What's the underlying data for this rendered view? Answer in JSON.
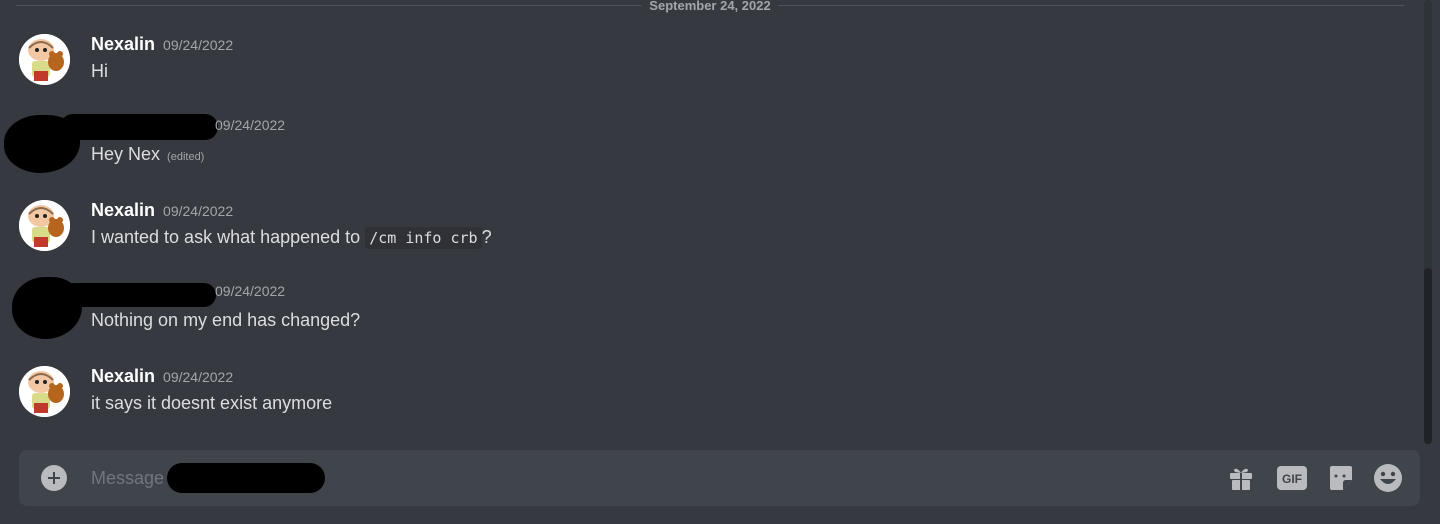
{
  "channel": {
    "date_divider": "September 24, 2022"
  },
  "messages": [
    {
      "username": "Nexalin",
      "timestamp": "09/24/2022",
      "text": "Hi",
      "edited": ""
    },
    {
      "username": "",
      "timestamp": "09/24/2022",
      "text": "Hey Nex",
      "edited": "(edited)"
    },
    {
      "username": "Nexalin",
      "timestamp": "09/24/2022",
      "text_before": "I wanted to ask what happened to",
      "code": "/cm info crb",
      "text_after": "?"
    },
    {
      "username": "",
      "timestamp": "09/24/2022",
      "text": "Nothing on my end has changed?"
    },
    {
      "username": "Nexalin",
      "timestamp": "09/24/2022",
      "text": "it says it doesnt exist anymore"
    }
  ],
  "composer": {
    "placeholder": "Message",
    "icons": [
      "plus-circle-icon",
      "gift-icon",
      "gif-icon",
      "sticker-icon",
      "emoji-icon"
    ],
    "gif_label": "GIF"
  },
  "colors": {
    "background": "#36393f",
    "composer": "#40444b",
    "username": "#ffffff",
    "text": "#dcddde",
    "muted": "#a3a6aa"
  }
}
